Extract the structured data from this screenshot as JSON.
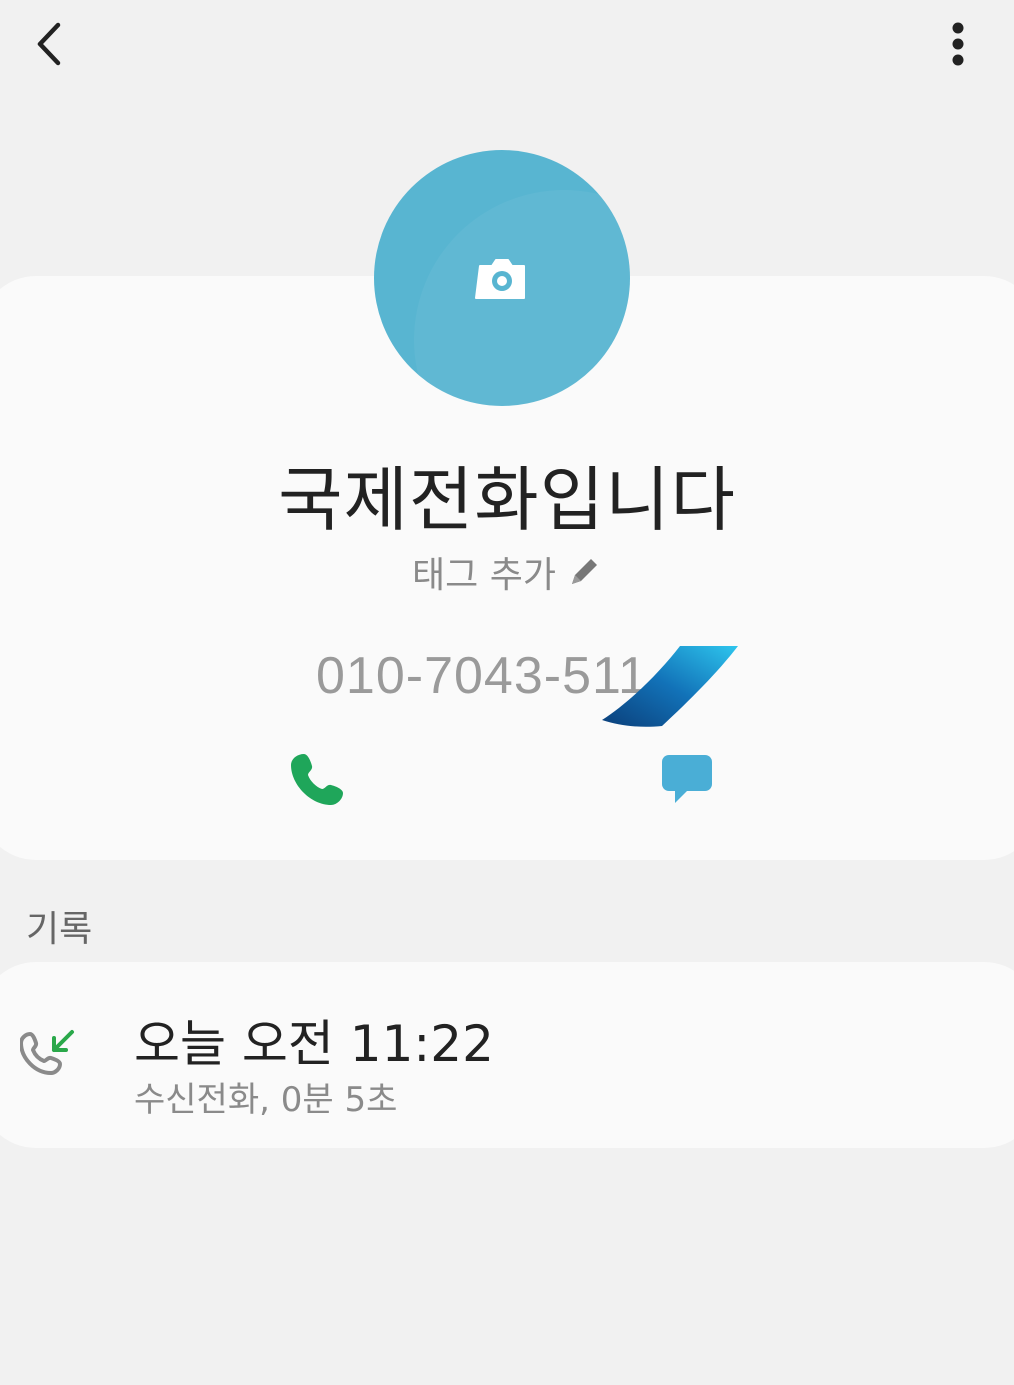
{
  "topbar": {
    "back_icon": "chevron-left-icon",
    "more_icon": "more-vertical-icon"
  },
  "contact": {
    "name": "국제전화입니다",
    "tag_label": "태그 추가",
    "tag_icon": "pencil-icon",
    "phone": "010-7043-511",
    "avatar_icon": "camera-icon",
    "avatar_color": "#58b5d1",
    "call_icon": "phone-icon",
    "call_color": "#1fa65a",
    "message_icon": "message-icon",
    "message_color": "#4aaed6"
  },
  "history": {
    "section_title": "기록",
    "entries": [
      {
        "time": "오늘 오전 11:22",
        "detail": "수신전화, 0분 5초",
        "icon": "incoming-call-icon",
        "arrow_color": "#2aa84a"
      }
    ]
  }
}
